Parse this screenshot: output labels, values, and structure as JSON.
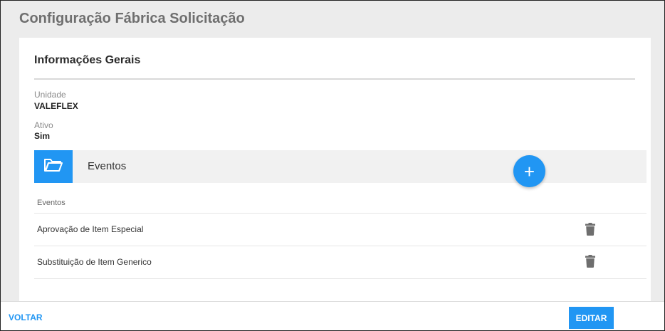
{
  "page": {
    "title": "Configuração Fábrica Solicitação"
  },
  "general": {
    "section_title": "Informações Gerais",
    "unit_label": "Unidade",
    "unit_value": "VALEFLEX",
    "active_label": "Ativo",
    "active_value": "Sim"
  },
  "events": {
    "header_title": "Eventos",
    "header_icon": "folder-open-icon",
    "add_button_label": "+",
    "column_header": "Eventos",
    "rows": [
      {
        "name": "Aprovação de Item Especial",
        "action_icon": "trash-icon"
      },
      {
        "name": "Substituição de Item Generico",
        "action_icon": "trash-icon"
      }
    ]
  },
  "footer": {
    "back_label": "VOLTAR",
    "edit_label": "EDITAR"
  },
  "colors": {
    "accent": "#2196f3",
    "page_background": "#ececec",
    "card_background": "#ffffff",
    "trash_icon": "#6e6e6e"
  }
}
